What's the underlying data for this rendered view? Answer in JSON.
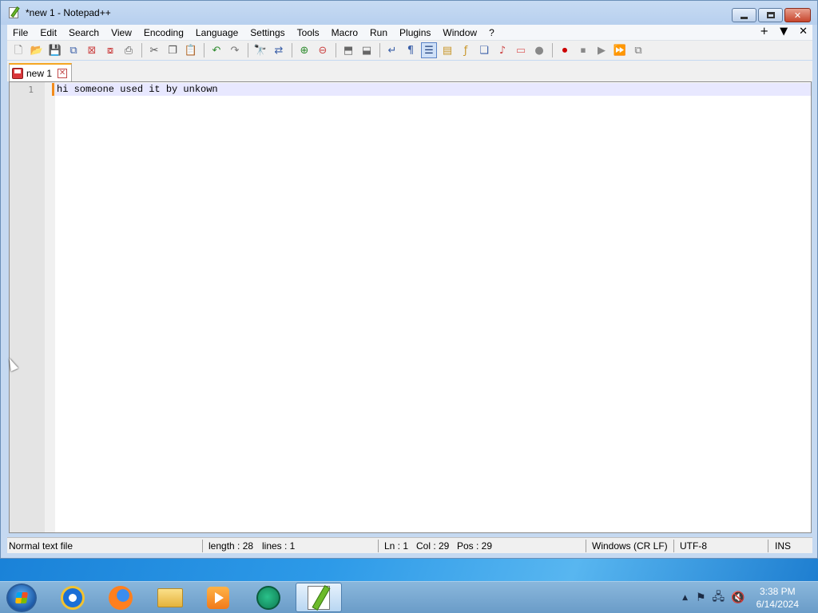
{
  "window": {
    "title": "*new 1 - Notepad++",
    "controls": {
      "minimize": "minimize",
      "maximize": "maximize",
      "close": "✕"
    }
  },
  "menu": {
    "items": [
      "File",
      "Edit",
      "Search",
      "View",
      "Encoding",
      "Language",
      "Settings",
      "Tools",
      "Macro",
      "Run",
      "Plugins",
      "Window",
      "?"
    ],
    "right": [
      "+",
      "▼",
      "✕"
    ]
  },
  "toolbar": {
    "icons": [
      "new-file-icon",
      "open-file-icon",
      "save-icon",
      "save-all-icon",
      "close-icon",
      "close-all-icon",
      "print-icon",
      "cut-icon",
      "copy-icon",
      "paste-icon",
      "undo-icon",
      "redo-icon",
      "find-icon",
      "replace-icon",
      "zoom-in-icon",
      "zoom-out-icon",
      "sync-vertical-icon",
      "sync-horizontal-icon",
      "word-wrap-icon",
      "show-all-chars-icon",
      "indent-guide-icon",
      "document-map-icon",
      "function-list-icon",
      "folder-workspace-icon",
      "monitoring-icon",
      "record-macro-icon",
      "stop-macro-icon",
      "play-macro-icon",
      "run-macro-multiple-icon",
      "save-macro-icon"
    ]
  },
  "tabs": [
    {
      "label": "new 1",
      "close": "✕"
    }
  ],
  "editor": {
    "lines": [
      {
        "number": "1",
        "text": "hi someone used it by unkown"
      }
    ]
  },
  "statusbar": {
    "file_type": "Normal text file",
    "length": "length : 28",
    "lines": "lines : 1",
    "ln": "Ln : 1",
    "col": "Col : 29",
    "pos": "Pos : 29",
    "eol": "Windows (CR LF)",
    "encoding": "UTF-8",
    "mode": "INS"
  },
  "taskbar": {
    "clock_time": "3:38 PM",
    "clock_date": "6/14/2024",
    "tray_arrow": "▲"
  }
}
